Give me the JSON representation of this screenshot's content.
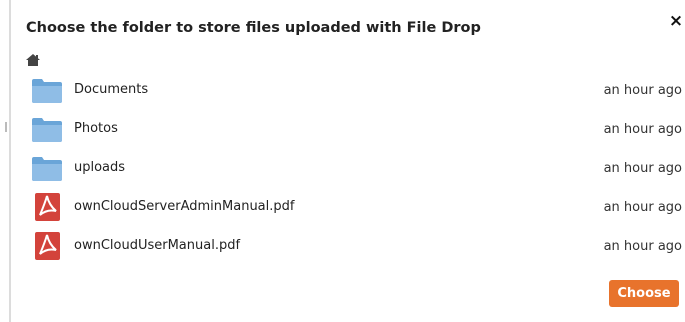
{
  "dialog": {
    "title": "Choose the folder to store files uploaded with File Drop",
    "close_label": "×",
    "choose_label": "Choose"
  },
  "files": [
    {
      "name": "Documents",
      "date": "an hour ago",
      "icon": "folder-icon"
    },
    {
      "name": "Photos",
      "date": "an hour ago",
      "icon": "folder-icon"
    },
    {
      "name": "uploads",
      "date": "an hour ago",
      "icon": "folder-icon"
    },
    {
      "name": "ownCloudServerAdminManual.pdf",
      "date": "an hour ago",
      "icon": "pdf-icon"
    },
    {
      "name": "ownCloudUserManual.pdf",
      "date": "an hour ago",
      "icon": "pdf-icon"
    }
  ],
  "colors": {
    "accent": "#e8732c",
    "folder": "#6aa5d8",
    "pdf": "#d3433b"
  }
}
